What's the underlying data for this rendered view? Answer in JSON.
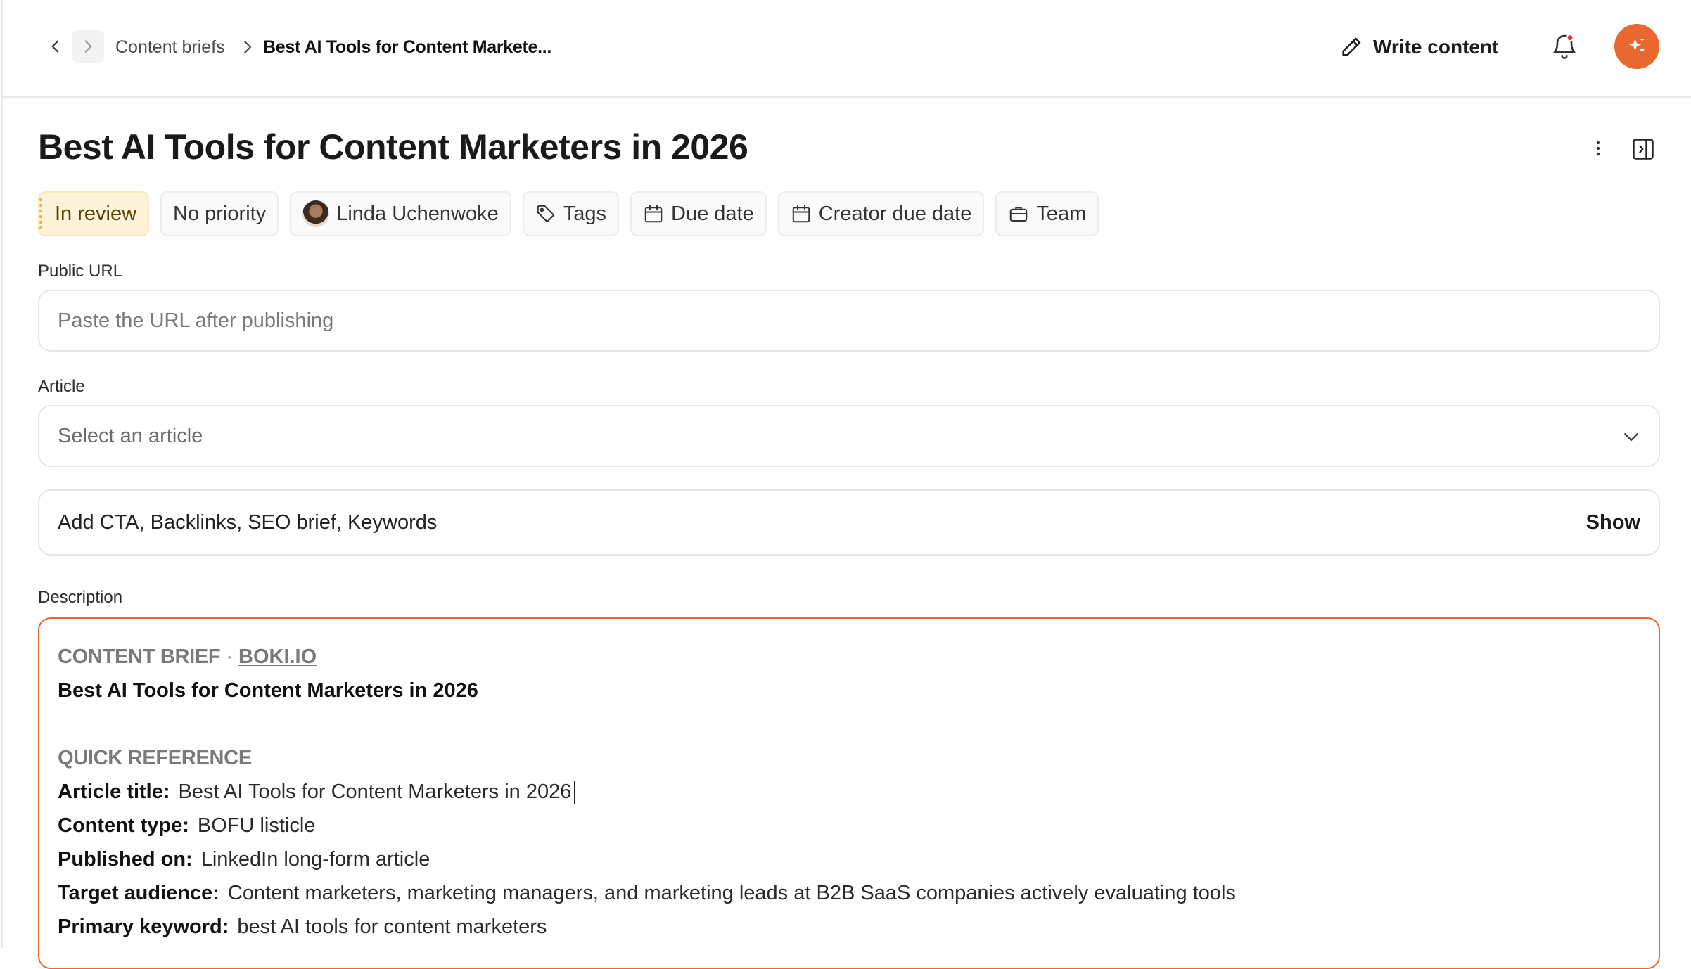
{
  "breadcrumb": {
    "parent": "Content briefs",
    "current": "Best AI Tools for Content Markete..."
  },
  "header": {
    "write_label": "Write content"
  },
  "brief": {
    "title": "Best AI Tools for Content Marketers in 2026",
    "chips": {
      "status": "In review",
      "priority": "No priority",
      "assignee": "Linda Uchenwoke",
      "tags": "Tags",
      "due_date": "Due date",
      "creator_due_date": "Creator due date",
      "team": "Team"
    }
  },
  "form": {
    "public_url_label": "Public URL",
    "public_url_placeholder": "Paste the URL after publishing",
    "article_label": "Article",
    "article_placeholder": "Select an article",
    "extras_label": "Add CTA, Backlinks, SEO brief, Keywords",
    "extras_toggle": "Show",
    "description_label": "Description"
  },
  "description": {
    "kicker": "CONTENT BRIEF",
    "kicker_link": "BOKI.IO",
    "heading": "Best AI Tools for Content Marketers in 2026",
    "section": "QUICK REFERENCE",
    "fields": [
      {
        "key": "Article title:",
        "value": "Best AI Tools for Content Marketers in 2026"
      },
      {
        "key": "Content type:",
        "value": "BOFU listicle"
      },
      {
        "key": "Published on:",
        "value": "LinkedIn long-form article"
      },
      {
        "key": "Target audience:",
        "value": "Content marketers, marketing managers, and marketing leads at B2B SaaS companies actively evaluating tools"
      },
      {
        "key": "Primary keyword:",
        "value": "best AI tools for content marketers"
      }
    ]
  },
  "colors": {
    "accent": "#e8682f",
    "status_bg": "#fdf3d9",
    "status_dots": "#e7b431"
  },
  "icons": [
    "chevron-left-icon",
    "chevron-right-icon",
    "pencil-icon",
    "bell-icon",
    "sparkle-icon",
    "kebab-icon",
    "panel-toggle-icon",
    "tag-icon",
    "calendar-icon",
    "briefcase-icon",
    "chevron-down-icon"
  ]
}
